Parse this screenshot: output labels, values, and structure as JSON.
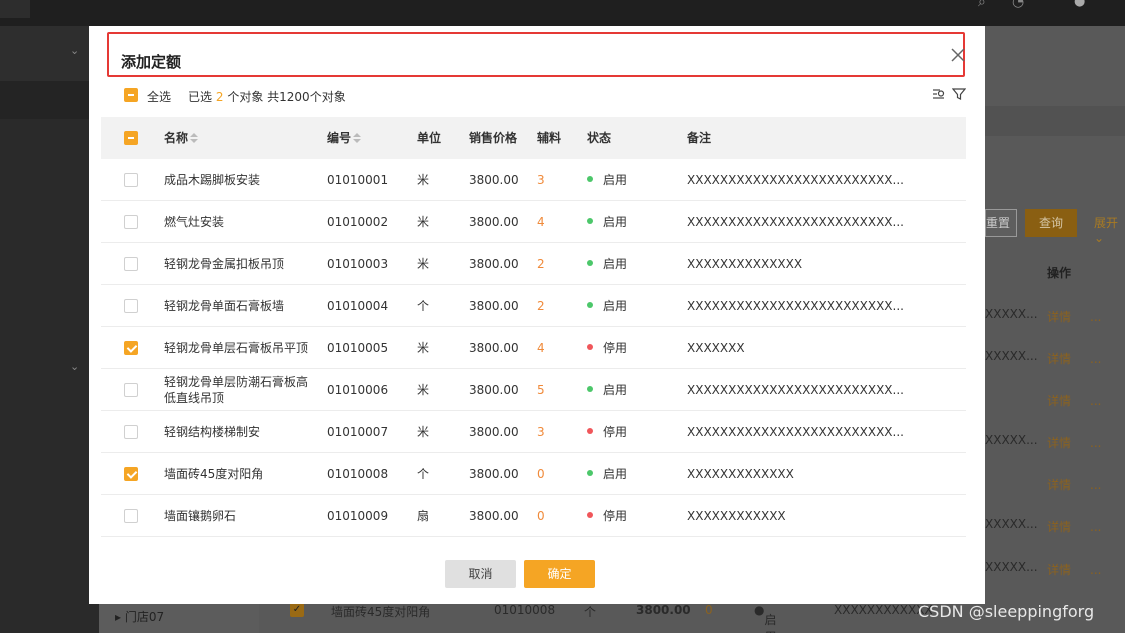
{
  "background": {
    "reset_label": "重置",
    "query_label": "查询",
    "expand_label": "展开",
    "operation_header": "操作",
    "row_truncated_text": "XXXXX...",
    "detail_label": "详情",
    "more_label": "...",
    "tree_item": "门店07",
    "bottom_row": {
      "name": "墙面砖45度对阳角",
      "code": "01010008",
      "unit": "个",
      "price": "3800.00",
      "aux": "0",
      "status": "启用",
      "note": "XXXXXXXXXXXX"
    }
  },
  "modal": {
    "title": "添加定额",
    "close_icon": "close-icon",
    "select_all_label": "全选",
    "selected_prefix": "已选",
    "selected_count": "2",
    "selected_suffix": "个对象",
    "total_text": "共1200个对象",
    "columns": {
      "name": "名称",
      "code": "编号",
      "unit": "单位",
      "price": "销售价格",
      "aux": "辅料",
      "status": "状态",
      "note": "备注"
    },
    "rows": [
      {
        "name": "成品木踢脚板安装",
        "code": "01010001",
        "unit": "米",
        "price": "3800.00",
        "aux": "3",
        "status": "启用",
        "note": "XXXXXXXXXXXXXXXXXXXXXXXXX...",
        "checked": false
      },
      {
        "name": "燃气灶安装",
        "code": "01010002",
        "unit": "米",
        "price": "3800.00",
        "aux": "4",
        "status": "启用",
        "note": "XXXXXXXXXXXXXXXXXXXXXXXXX...",
        "checked": false
      },
      {
        "name": "轻钢龙骨金属扣板吊顶",
        "code": "01010003",
        "unit": "米",
        "price": "3800.00",
        "aux": "2",
        "status": "启用",
        "note": "XXXXXXXXXXXXXX",
        "checked": false
      },
      {
        "name": "轻钢龙骨单面石膏板墙",
        "code": "01010004",
        "unit": "个",
        "price": "3800.00",
        "aux": "2",
        "status": "启用",
        "note": "XXXXXXXXXXXXXXXXXXXXXXXXX...",
        "checked": false
      },
      {
        "name": "轻钢龙骨单层石膏板吊平顶",
        "code": "01010005",
        "unit": "米",
        "price": "3800.00",
        "aux": "4",
        "status": "停用",
        "note": "XXXXXXX",
        "checked": true
      },
      {
        "name": "轻钢龙骨单层防潮石膏板高低直线吊顶",
        "code": "01010006",
        "unit": "米",
        "price": "3800.00",
        "aux": "5",
        "status": "启用",
        "note": "XXXXXXXXXXXXXXXXXXXXXXXXX...",
        "checked": false
      },
      {
        "name": "轻钢结构楼梯制安",
        "code": "01010007",
        "unit": "米",
        "price": "3800.00",
        "aux": "3",
        "status": "停用",
        "note": "XXXXXXXXXXXXXXXXXXXXXXXXX...",
        "checked": false
      },
      {
        "name": "墙面砖45度对阳角",
        "code": "01010008",
        "unit": "个",
        "price": "3800.00",
        "aux": "0",
        "status": "启用",
        "note": "XXXXXXXXXXXXX",
        "checked": true
      },
      {
        "name": "墙面镶鹅卵石",
        "code": "01010009",
        "unit": "扇",
        "price": "3800.00",
        "aux": "0",
        "status": "停用",
        "note": "XXXXXXXXXXXX",
        "checked": false
      }
    ],
    "cancel_label": "取消",
    "ok_label": "确定"
  },
  "watermark": "CSDN @sleeppingforg",
  "colors": {
    "accent": "#f5a524",
    "status_enabled": "#4cc76a",
    "status_disabled": "#f0565a",
    "highlight_border": "#e53935"
  }
}
